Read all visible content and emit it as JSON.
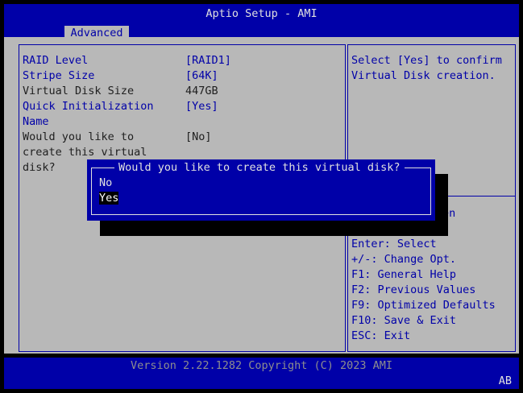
{
  "header": {
    "title": "Aptio Setup - AMI",
    "tab": "Advanced"
  },
  "settings": [
    {
      "label": "RAID Level",
      "value": "[RAID1]"
    },
    {
      "label": "Stripe Size",
      "value": "[64K]"
    },
    {
      "label": "Virtual Disk Size",
      "value": "447GB"
    },
    {
      "label": "Quick Initialization",
      "value": "[Yes]"
    },
    {
      "label": "Name",
      "value": ""
    },
    {
      "label_lines": [
        "Would you like to",
        "create this virtual",
        "disk?"
      ],
      "value": "[No]"
    }
  ],
  "help": {
    "lines": [
      "Select [Yes] to confirm",
      "Virtual Disk creation."
    ]
  },
  "hints": {
    "partial": "en",
    "items": [
      "Enter: Select",
      "+/-: Change Opt.",
      "F1: General Help",
      "F2: Previous Values",
      "F9: Optimized Defaults",
      "F10: Save & Exit",
      "ESC: Exit"
    ]
  },
  "dialog": {
    "title": "Would you like to create this virtual disk?",
    "options": [
      "No",
      "Yes"
    ],
    "selected": "Yes"
  },
  "footer": {
    "version": "Version 2.22.1282 Copyright (C) 2023 AMI",
    "corner": "AB"
  },
  "colors": {
    "blue": "#0000a8",
    "gray": "#b8b8b8",
    "text_light": "#e0e0e0"
  }
}
